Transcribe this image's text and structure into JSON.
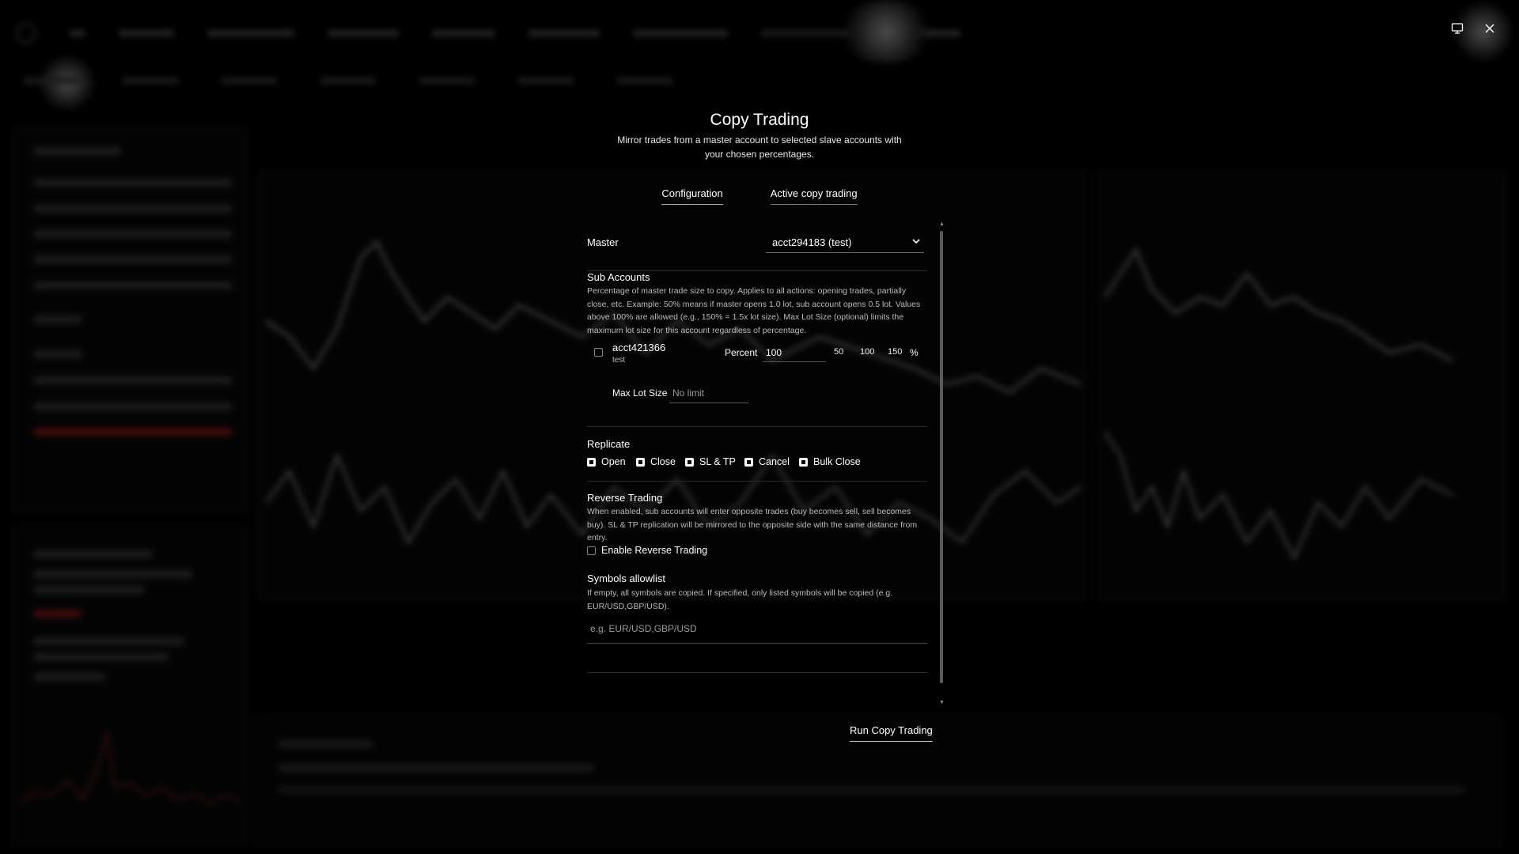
{
  "modal": {
    "title": "Copy Trading",
    "subtitle": "Mirror trades from a master account to selected slave accounts with your chosen percentages.",
    "tabs": [
      {
        "label": "Configuration",
        "active": true
      },
      {
        "label": "Active copy trading",
        "active": false
      }
    ],
    "master": {
      "label": "Master",
      "selected": "acct294183 (test)"
    },
    "sub_accounts": {
      "label": "Sub Accounts",
      "description": "Percentage of master trade size to copy. Applies to all actions: opening trades, partially close, etc. Example: 50% means if master opens 1.0 lot, sub account opens 0.5 lot. Values above 100% are allowed (e.g., 150% = 1.5x lot size). Max Lot Size (optional) limits the maximum lot size for this account regardless of percentage.",
      "accounts": [
        {
          "name": "acct421366",
          "tag": "test",
          "checked": false,
          "percent_label": "Percent",
          "percent_value": "100",
          "presets": [
            "50",
            "100",
            "150"
          ],
          "percent_sign": "%",
          "max_lot_label": "Max Lot Size",
          "max_lot_placeholder": "No limit"
        }
      ]
    },
    "replicate": {
      "label": "Replicate",
      "options": [
        {
          "label": "Open",
          "checked": true
        },
        {
          "label": "Close",
          "checked": true
        },
        {
          "label": "SL & TP",
          "checked": true
        },
        {
          "label": "Cancel",
          "checked": true
        },
        {
          "label": "Bulk Close",
          "checked": true
        }
      ]
    },
    "reverse_trading": {
      "label": "Reverse Trading",
      "description": "When enabled, sub accounts will enter opposite trades (buy becomes sell, sell becomes buy). SL & TP replication will be mirrored to the opposite side with the same distance from entry.",
      "checkbox_label": "Enable Reverse Trading",
      "checked": false
    },
    "symbols_allowlist": {
      "label": "Symbols allowlist",
      "description": "If empty, all symbols are copied. If specified, only listed symbols will be copied (e.g. EUR/USD,GBP/USD).",
      "placeholder": "e.g. EUR/USD,GBP/USD"
    },
    "run_button": "Run Copy Trading"
  },
  "window_controls": {
    "icons": [
      "monitor-icon",
      "close-icon"
    ]
  },
  "colors": {
    "background": "#000000",
    "text": "#ffffff",
    "muted_text": "#bcbcbc",
    "divider": "#2b2b2b"
  }
}
